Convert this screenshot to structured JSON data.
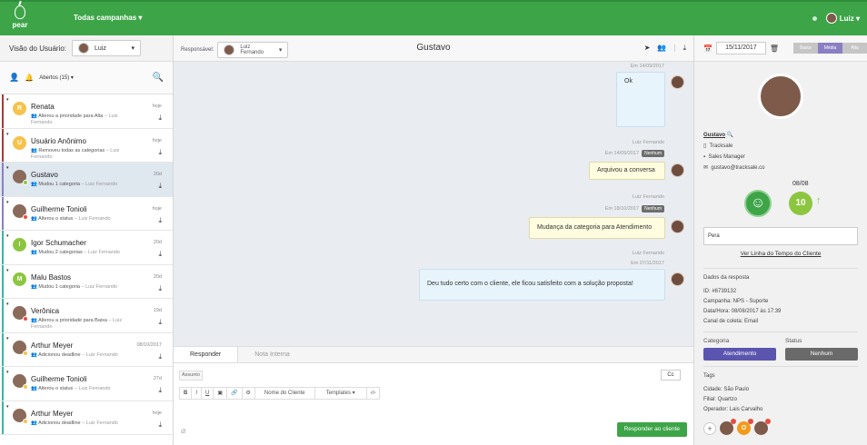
{
  "app": {
    "logo_text": "pear",
    "campaigns_label": "Todas campanhas ▾",
    "user_label": "Luiz ▾"
  },
  "left": {
    "view_label": "Visão do Usuário:",
    "view_value": "Luiz",
    "filter_label": "Abertos (15) ▾",
    "conversations": [
      {
        "initial": "R",
        "color": "#f5c24a",
        "bar": "#a23b3b",
        "name": "Renata",
        "activity": "Alterou a prioridade para Alta",
        "who": "Luiz Fernando",
        "date": "hoje",
        "photo": false
      },
      {
        "initial": "U",
        "color": "#f5c24a",
        "bar": "#a23b3b",
        "name": "Usuário Anônimo",
        "activity": "Removeu todas as categorias",
        "who": "Luiz Fernando",
        "date": "hoje",
        "photo": false
      },
      {
        "initial": "",
        "color": "#8a6a5a",
        "bar": "#8a7fc4",
        "name": "Gustavo",
        "activity": "Mudou 1 categoria",
        "who": "Luiz Fernando",
        "date": "20d",
        "photo": true,
        "badge": "#8cc63f",
        "active": true
      },
      {
        "initial": "",
        "color": "#8a6a5a",
        "bar": "#8a7fc4",
        "name": "Guilherme Tonioli",
        "activity": "Alterou o status",
        "who": "Luiz Fernando",
        "date": "hoje",
        "photo": true,
        "badge": "#e84c3d"
      },
      {
        "initial": "I",
        "color": "#8cc63f",
        "bar": "#3ab5a3",
        "name": "Igor Schumacher",
        "activity": "Mudou 2 categorias",
        "who": "Luiz Fernando",
        "date": "20d",
        "photo": false
      },
      {
        "initial": "M",
        "color": "#8cc63f",
        "bar": "#3ab5a3",
        "name": "Malu Bastos",
        "activity": "Mudou 1 categoria",
        "who": "Luiz Fernando",
        "date": "20d",
        "photo": false
      },
      {
        "initial": "",
        "color": "#8a6a5a",
        "bar": "#3ab5a3",
        "name": "Verônica",
        "activity": "Alterou a prioridade para Baixa",
        "who": "Luiz Fernando",
        "date": "19d",
        "photo": true,
        "badge": "#e84c3d"
      },
      {
        "initial": "",
        "color": "#8a6a5a",
        "bar": "#3ab5a3",
        "name": "Arthur Meyer",
        "activity": "Adicionou deadline",
        "who": "Luiz Fernando",
        "date": "08/10/2017",
        "photo": true,
        "badge": "#f5c24a"
      },
      {
        "initial": "",
        "color": "#8a6a5a",
        "bar": "#3ab5a3",
        "name": "Guilherme Tonioli",
        "activity": "Alterou o status",
        "who": "Luiz Fernando",
        "date": "27d",
        "photo": true,
        "badge": "#f5c24a"
      },
      {
        "initial": "",
        "color": "#8a6a5a",
        "bar": "#3ab5a3",
        "name": "Arthur Meyer",
        "activity": "Adicionou deadline",
        "who": "Luiz Fernando",
        "date": "hoje",
        "photo": true,
        "badge": "#f5c24a"
      }
    ]
  },
  "chat": {
    "responsible_label": "Responsável:",
    "responsible_value": "Luiz Fernando",
    "title": "Gustavo",
    "top_meta": "Em 14/09/2017",
    "msg1": "Ok",
    "agent_name": "Luiz Fernando",
    "meta2": "Em 14/09/2017",
    "tag2": "Nenhum",
    "msg2": "Arquivou a conversa",
    "meta3": "Em 18/10/2017",
    "tag3": "Nenhum",
    "msg3": "Mudança da categoria para Atendimento",
    "meta4": "Em 07/11/2017",
    "msg4": "Deu tudo certo com o cliente, ele ficou satisfeito com a solução proposta!",
    "tab_reply": "Responder",
    "tab_note": "Nota Interna",
    "subject": "Assunto",
    "cc": "Cc",
    "toolbar": [
      "B",
      "I",
      "U",
      "▣",
      "🔗",
      "⚙",
      "Nome do Cliente",
      "Templates ▾",
      "‹/›"
    ],
    "send": "Responder ao cliente"
  },
  "right": {
    "date": "15/11/2017",
    "priority": [
      "Baixa",
      "Média",
      "Alta"
    ],
    "name": "Gustavo",
    "company": "Tracksale",
    "role": "Sales Manager",
    "email": "gustavo@tracksale.co",
    "score_date": "08/08",
    "score": "10",
    "comment": "Pera",
    "timeline_link": "Ver Linha do Tempo do Cliente",
    "answer_title": "Dados da resposta",
    "answer_id": "ID: #6739132",
    "answer_campaign": "Campanha: NPS - Suporte",
    "answer_datetime": "Data/Hora: 08/08/2017 às 17:39",
    "answer_channel": "Canal de coleta: Email",
    "category_label": "Categoria",
    "status_label": "Status",
    "category_value": "Atendimento",
    "status_value": "Nenhum",
    "tags_title": "Tags",
    "tag_city": "Cidade: São Paulo",
    "tag_branch": "Filial: Quartzo",
    "tag_operator": "Operador: Lais Carvalho",
    "bottom_o": "O"
  }
}
